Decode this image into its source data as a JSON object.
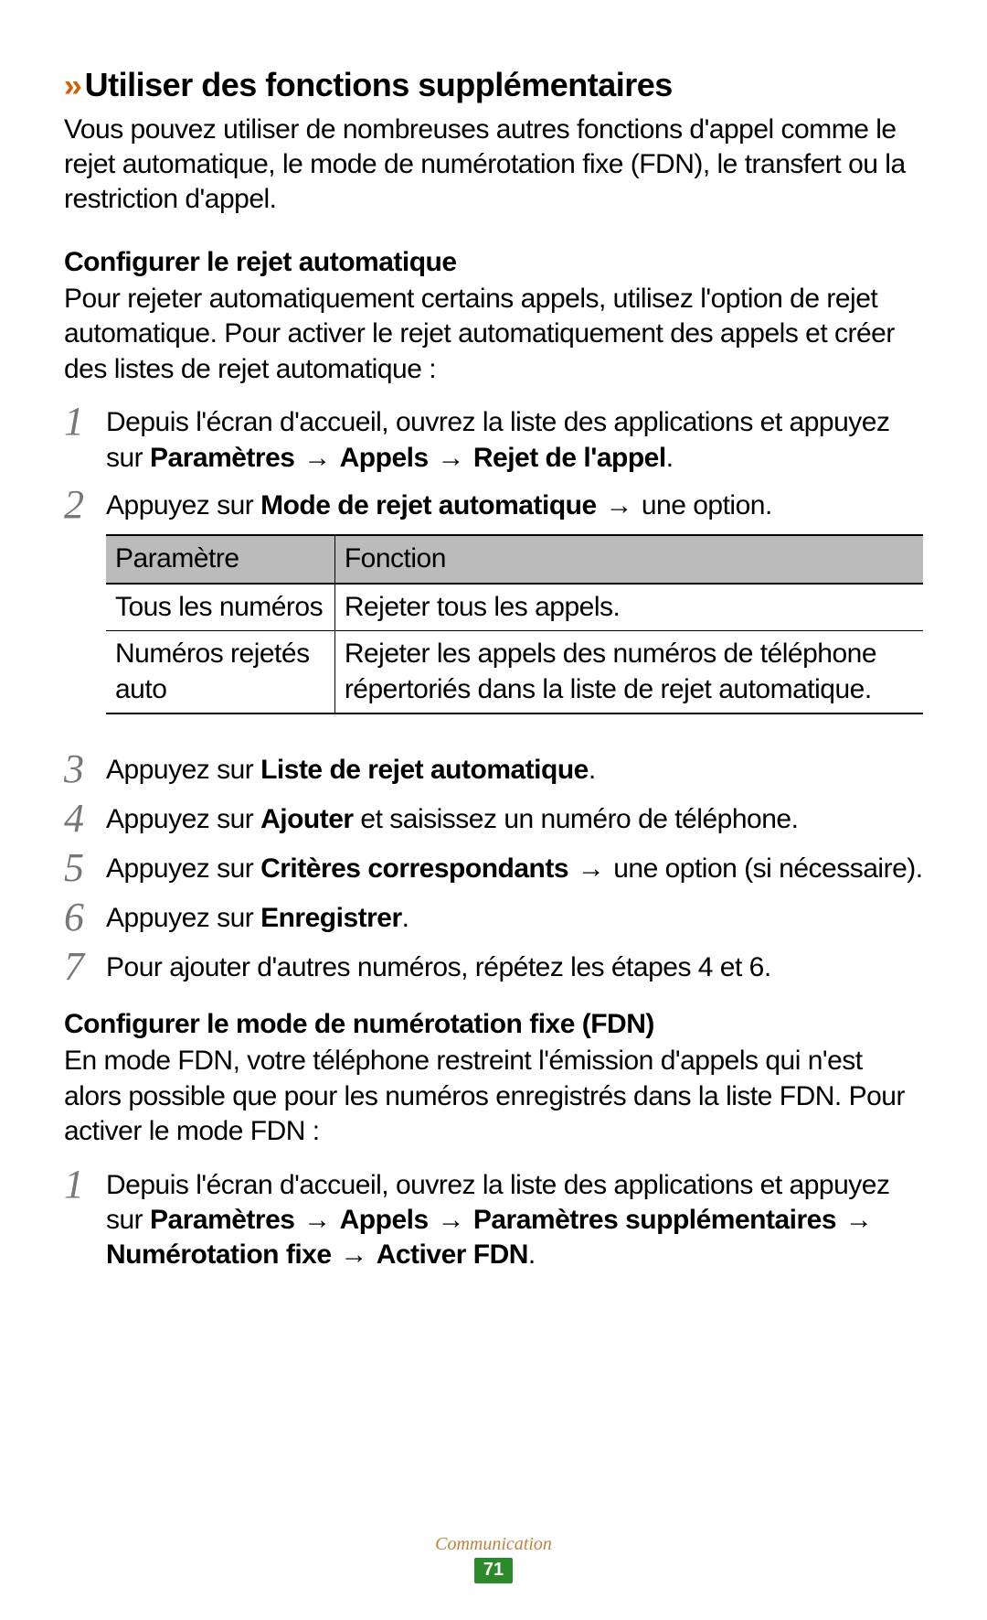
{
  "section": {
    "chevron": "››",
    "title": "Utiliser des fonctions supplémentaires",
    "intro": "Vous pouvez utiliser de nombreuses autres fonctions d'appel comme le rejet automatique, le mode de numérotation fixe (FDN), le transfert ou la restriction d'appel."
  },
  "auto_reject": {
    "title": "Configurer le rejet automatique",
    "intro": "Pour rejeter automatiquement certains appels, utilisez l'option de rejet automatique. Pour activer le rejet automatiquement des appels et créer des listes de rejet automatique :",
    "steps_a": {
      "s1": {
        "num": "1",
        "pre": "Depuis l'écran d'accueil, ouvrez la liste des applications et appuyez sur ",
        "b1": "Paramètres",
        "arr1": " → ",
        "b2": "Appels",
        "arr2": " → ",
        "b3": "Rejet de l'appel",
        "post": "."
      },
      "s2": {
        "num": "2",
        "pre": "Appuyez sur ",
        "b1": "Mode de rejet automatique",
        "arr1": " → ",
        "post": "une option."
      }
    },
    "table": {
      "h1": "Paramètre",
      "h2": "Fonction",
      "rows": [
        {
          "p": "Tous les numéros",
          "f": "Rejeter tous les appels."
        },
        {
          "p": "Numéros rejetés auto",
          "f": "Rejeter les appels des numéros de téléphone répertoriés dans la liste de rejet automatique."
        }
      ]
    },
    "steps_b": {
      "s3": {
        "num": "3",
        "pre": "Appuyez sur ",
        "b1": "Liste de rejet automatique",
        "post": "."
      },
      "s4": {
        "num": "4",
        "pre": "Appuyez sur ",
        "b1": "Ajouter",
        "post": " et saisissez un numéro de téléphone."
      },
      "s5": {
        "num": "5",
        "pre": "Appuyez sur ",
        "b1": "Critères correspondants",
        "arr1": " → ",
        "post": "une option (si nécessaire)."
      },
      "s6": {
        "num": "6",
        "pre": "Appuyez sur ",
        "b1": "Enregistrer",
        "post": "."
      },
      "s7": {
        "num": "7",
        "text": "Pour ajouter d'autres numéros, répétez les étapes 4 et 6."
      }
    }
  },
  "fdn": {
    "title": "Configurer le mode de numérotation fixe (FDN)",
    "intro": "En mode FDN, votre téléphone restreint l'émission d'appels qui n'est alors possible que pour les numéros enregistrés dans la liste FDN. Pour activer le mode FDN :",
    "steps": {
      "s1": {
        "num": "1",
        "pre": "Depuis l'écran d'accueil, ouvrez la liste des applications et appuyez sur ",
        "b1": "Paramètres",
        "arr1": " → ",
        "b2": "Appels",
        "arr2": " → ",
        "b3": "Paramètres supplémentaires",
        "arr3": " → ",
        "b4": "Numérotation fixe",
        "arr4": " → ",
        "b5": "Activer FDN",
        "post": "."
      }
    }
  },
  "footer": {
    "section": "Communication",
    "page": "71"
  }
}
